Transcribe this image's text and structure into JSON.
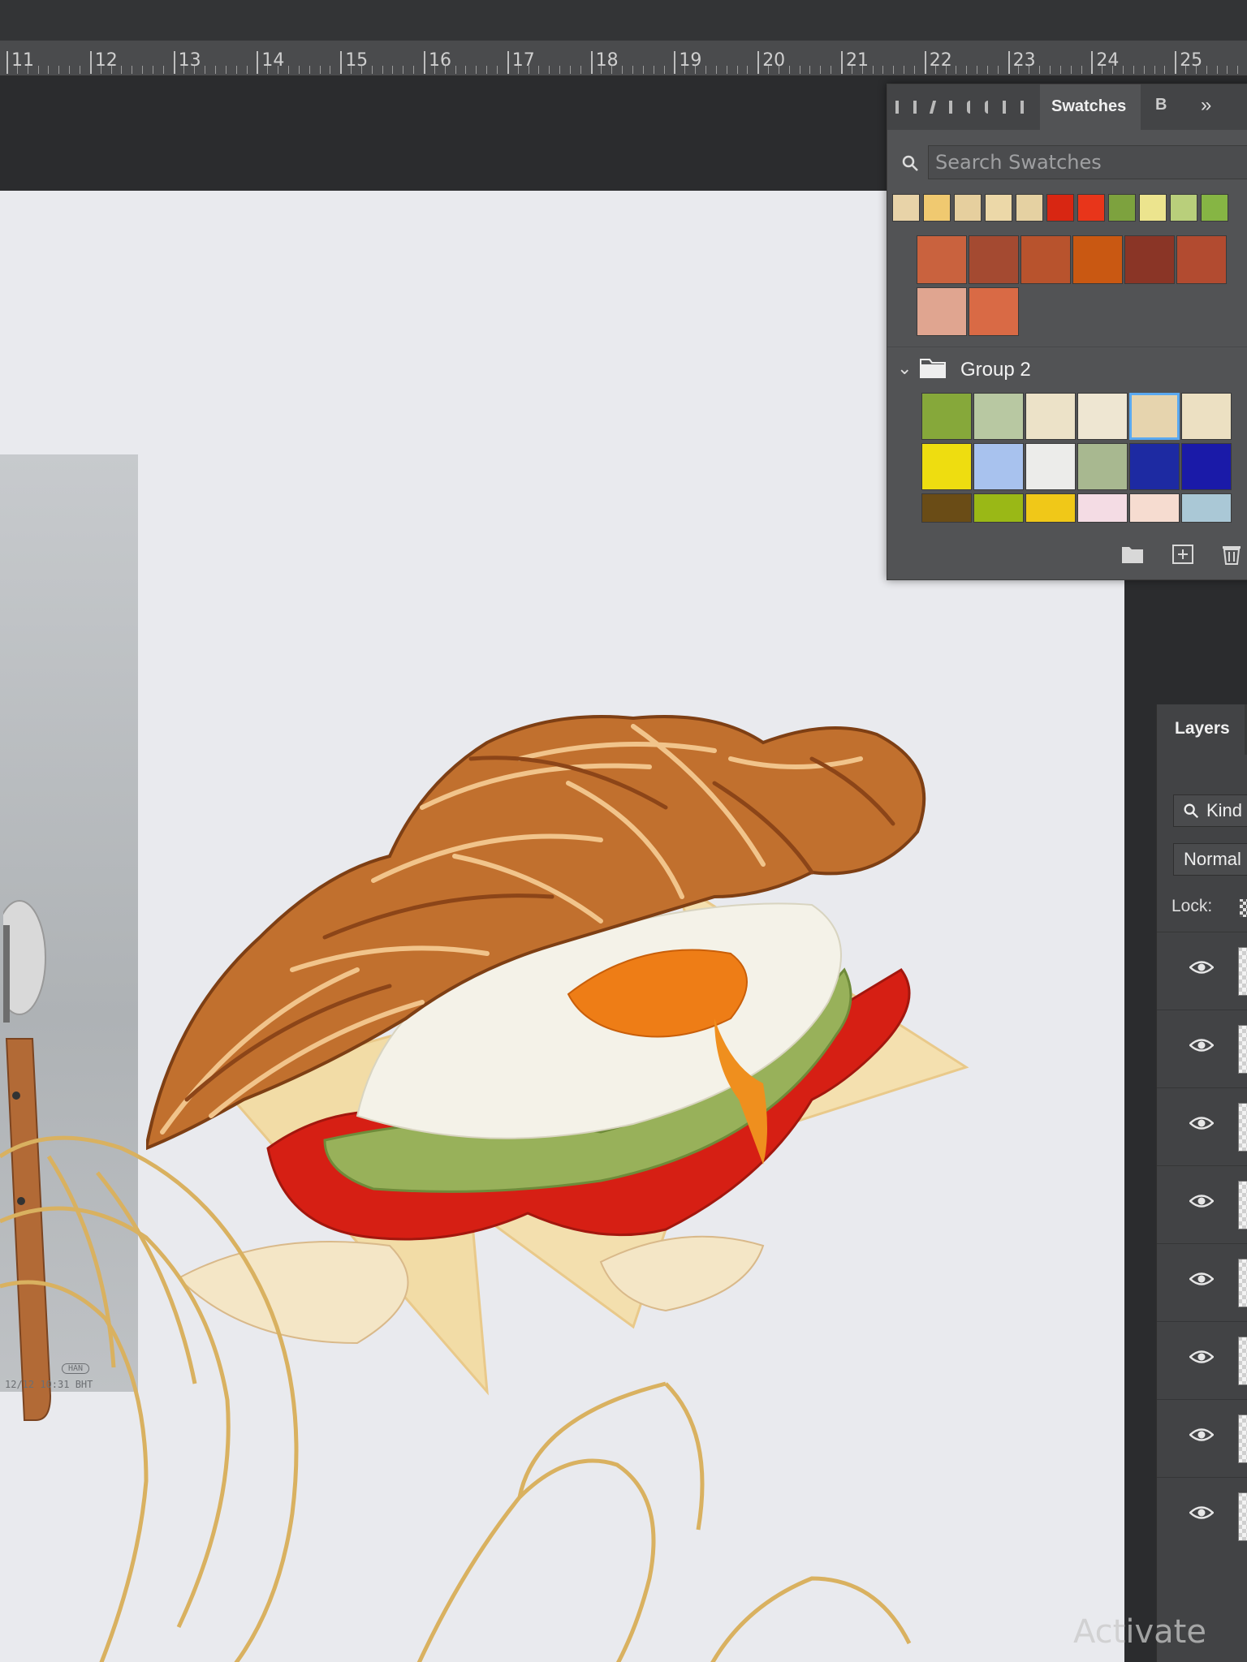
{
  "ruler": {
    "numbers": [
      "11",
      "12",
      "13",
      "14",
      "15",
      "16",
      "17",
      "18",
      "19",
      "20",
      "21",
      "22",
      "23",
      "24",
      "25"
    ]
  },
  "swatches_panel": {
    "tab_label": "Swatches",
    "extra_tab": "B",
    "search_placeholder": "Search Swatches",
    "strip_colors": [
      "#e8d3a8",
      "#f0c970",
      "#e6cf9e",
      "#ecd8a8",
      "#e5d1a2",
      "#d82612",
      "#e8351a",
      "#7da23e",
      "#ece48e",
      "#b9cf7b",
      "#86b544"
    ],
    "group1_colors": [
      "#c9623e",
      "#a44a31",
      "#b8532d",
      "#c95812",
      "#8a3526",
      "#b24b30",
      "#e0a590",
      "#d96a45"
    ],
    "group2": {
      "name": "Group 2",
      "colors": [
        "#86a83a",
        "#b8c8a2",
        "#ece2c8",
        "#eee6d2",
        "#e6d4ae",
        "#ece0c2",
        "#eedd10",
        "#a8c2ee",
        "#ececea",
        "#a8b890",
        "#1d2aa2",
        "#1a1aa8",
        "#6a4c16",
        "#9ab816",
        "#f0c818",
        "#f4dce4",
        "#f6dcd0",
        "#aac8d6"
      ],
      "selected_index": 4
    }
  },
  "layers_panel": {
    "tab_label": "Layers",
    "filter_label": "Kind",
    "blend_mode": "Normal",
    "lock_label": "Lock:",
    "row_count": 8
  },
  "canvas": {
    "reference_watermark": "HAN",
    "reference_caption": "12/12 10:31 BHT"
  },
  "activate_text": "Activate"
}
